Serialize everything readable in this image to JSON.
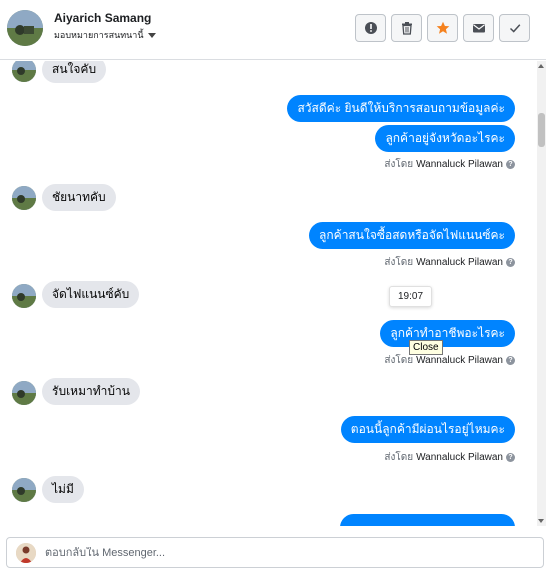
{
  "header": {
    "name": "Aiyarich Samang",
    "assign_label": "มอบหมายการสนทนานี้",
    "buttons": [
      "alert-icon",
      "trash-icon",
      "star-icon",
      "mail-icon",
      "check-icon"
    ],
    "star_color": "#f5821f"
  },
  "messages": [
    {
      "from": "customer",
      "text": "สนใจคับ"
    },
    {
      "from": "page",
      "text": "สวัสดีค่ะ  ยินดีให้บริการสอบถามข้อมูลค่ะ"
    },
    {
      "from": "page",
      "text": "ลูกค้าอยู่จังหวัดอะไรคะ"
    },
    {
      "from": "customer",
      "text": "ชัยนาทคับ"
    },
    {
      "from": "page",
      "text": "ลูกค้าสนใจซื้อสดหรือจัดไฟแนนซ์คะ"
    },
    {
      "from": "customer",
      "text": "จัดไฟแนนซ์คับ"
    },
    {
      "from": "page",
      "text": "ลูกค้าทำอาชีพอะไรคะ"
    },
    {
      "from": "customer",
      "text": "รับเหมาทำบ้าน"
    },
    {
      "from": "page",
      "text": "ตอนนี้ลูกค้ามีผ่อนไรอยู่ไหมคะ"
    },
    {
      "from": "customer",
      "text": "ไม่มี"
    }
  ],
  "sent_by": {
    "prefix": "ส่งโดย",
    "agent": "Wannaluck Pilawan"
  },
  "tooltips": {
    "time": "19:07",
    "close": "Close"
  },
  "composer": {
    "placeholder": "ตอบกลับใน Messenger..."
  },
  "colors": {
    "outgoing_bubble": "#0084ff",
    "incoming_bubble": "#e4e6eb"
  }
}
